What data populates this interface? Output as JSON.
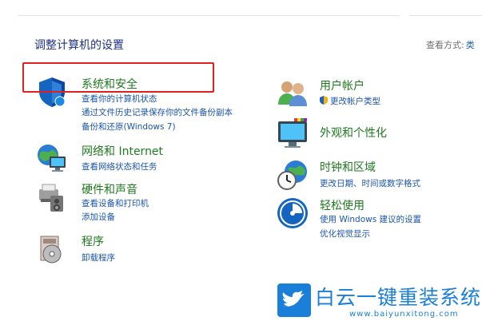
{
  "header": {
    "title": "调整计算机的设置",
    "view_by_label": "查看方式:",
    "view_by_value": "类"
  },
  "categories_left": [
    {
      "title": "系统和安全",
      "icon": "shield-icon",
      "links": [
        "查看你的计算机状态",
        "通过文件历史记录保存你的文件备份副本",
        "备份和还原(Windows 7)"
      ]
    },
    {
      "title": "网络和 Internet",
      "icon": "network-globe-icon",
      "links": [
        "查看网络状态和任务"
      ]
    },
    {
      "title": "硬件和声音",
      "icon": "printer-speaker-icon",
      "links": [
        "查看设备和打印机",
        "添加设备"
      ]
    },
    {
      "title": "程序",
      "icon": "programs-disc-icon",
      "links": [
        "卸载程序"
      ]
    }
  ],
  "categories_right": [
    {
      "title": "用户帐户",
      "icon": "users-icon",
      "links": [
        "更改帐户类型"
      ]
    },
    {
      "title": "外观和个性化",
      "icon": "monitor-palette-icon",
      "links": []
    },
    {
      "title": "时钟和区域",
      "icon": "clock-globe-icon",
      "links": [
        "更改日期、时间或数字格式"
      ]
    },
    {
      "title": "轻松使用",
      "icon": "ease-of-access-icon",
      "links": [
        "使用 Windows 建议的设置",
        "优化视觉显示"
      ]
    }
  ],
  "watermark": {
    "title": "白云一键重装系统",
    "url": "www.baiyunxitong.com"
  },
  "colors": {
    "category_title": "#1e7a1e",
    "link": "#1a55b0",
    "page_title": "#1e3287",
    "highlight": "#e02020",
    "watermark": "#1a7fd8"
  }
}
